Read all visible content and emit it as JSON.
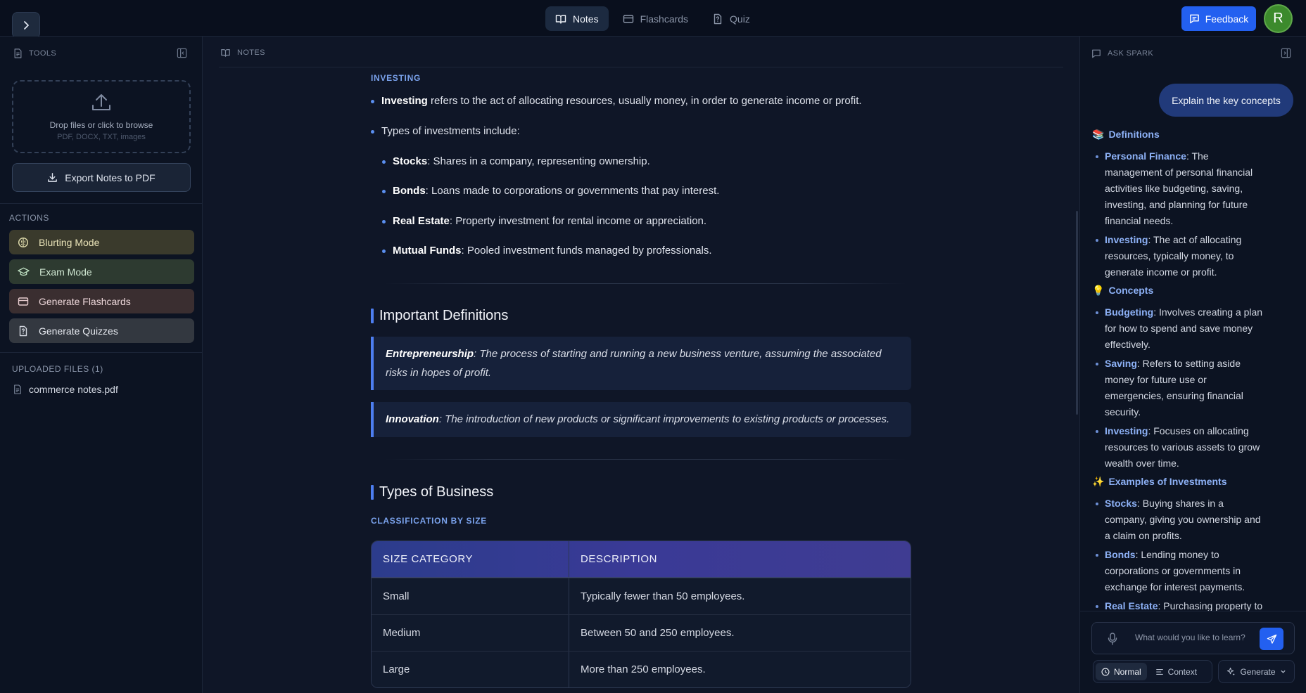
{
  "header": {
    "tabs": [
      {
        "label": "Notes",
        "active": true
      },
      {
        "label": "Flashcards",
        "active": false
      },
      {
        "label": "Quiz",
        "active": false
      }
    ],
    "feedback_label": "Feedback",
    "avatar_initial": "R"
  },
  "tools_panel": {
    "title": "TOOLS",
    "dropzone_text": "Drop files or click to browse",
    "dropzone_subtext": "PDF, DOCX, TXT, images",
    "export_label": "Export Notes to PDF",
    "actions_title": "ACTIONS",
    "actions": [
      {
        "label": "Blurting Mode",
        "icon": "brain-icon",
        "color": "#3a3a2c"
      },
      {
        "label": "Exam Mode",
        "icon": "graduation-cap-icon",
        "color": "#2d3a30"
      },
      {
        "label": "Generate Flashcards",
        "icon": "card-icon",
        "color": "#3a2e30"
      },
      {
        "label": "Generate Quizzes",
        "icon": "quiz-icon",
        "color": "#333840"
      }
    ],
    "uploaded_title": "UPLOADED FILES (1)",
    "files": [
      "commerce notes.pdf"
    ]
  },
  "notes": {
    "title": "NOTES",
    "investing_kicker": "INVESTING",
    "investing_def": {
      "term": "Investing",
      "text": " refers to the act of allocating resources, usually money, in order to generate income or profit."
    },
    "types_intro": "Types of investments include:",
    "investment_types": [
      {
        "term": "Stocks",
        "text": ": Shares in a company, representing ownership."
      },
      {
        "term": "Bonds",
        "text": ": Loans made to corporations or governments that pay interest."
      },
      {
        "term": "Real Estate",
        "text": ": Property investment for rental income or appreciation."
      },
      {
        "term": "Mutual Funds",
        "text": ": Pooled investment funds managed by professionals."
      }
    ],
    "definitions_heading": "Important Definitions",
    "definitions": [
      {
        "term": "Entrepreneurship",
        "text": ": The process of starting and running a new business venture, assuming the associated risks in hopes of profit."
      },
      {
        "term": "Innovation",
        "text": ": The introduction of new products or significant improvements to existing products or processes."
      }
    ],
    "business_heading": "Types of Business",
    "classification_kicker": "CLASSIFICATION BY SIZE",
    "table": {
      "headers": [
        "SIZE CATEGORY",
        "DESCRIPTION"
      ],
      "rows": [
        [
          "Small",
          "Typically fewer than 50 employees."
        ],
        [
          "Medium",
          "Between 50 and 250 employees."
        ],
        [
          "Large",
          "More than 250 employees."
        ]
      ]
    }
  },
  "spark": {
    "title": "ASK SPARK",
    "user_message": "Explain the key concepts",
    "sections": [
      {
        "emoji": "📚",
        "heading": "Definitions",
        "items": [
          {
            "term": "Personal Finance",
            "text": ": The management of personal financial activities like budgeting, saving, investing, and planning for future financial needs."
          },
          {
            "term": "Investing",
            "text": ": The act of allocating resources, typically money, to generate income or profit."
          }
        ]
      },
      {
        "emoji": "💡",
        "heading": "Concepts",
        "items": [
          {
            "term": "Budgeting",
            "text": ": Involves creating a plan for how to spend and save money effectively."
          },
          {
            "term": "Saving",
            "text": ": Refers to setting aside money for future use or emergencies, ensuring financial security."
          },
          {
            "term": "Investing",
            "text": ": Focuses on allocating resources to various assets to grow wealth over time."
          }
        ]
      },
      {
        "emoji": "✨",
        "heading": "Examples of Investments",
        "items": [
          {
            "term": "Stocks",
            "text": ": Buying shares in a company, giving you ownership and a claim on profits."
          },
          {
            "term": "Bonds",
            "text": ": Lending money to corporations or governments in exchange for interest payments."
          },
          {
            "term": "Real Estate",
            "text": ": Purchasing property to"
          }
        ]
      }
    ],
    "input_placeholder": "What would you like to learn?",
    "modes": [
      {
        "label": "Normal",
        "active": true
      },
      {
        "label": "Context",
        "active": false
      }
    ],
    "generate_label": "Generate"
  }
}
